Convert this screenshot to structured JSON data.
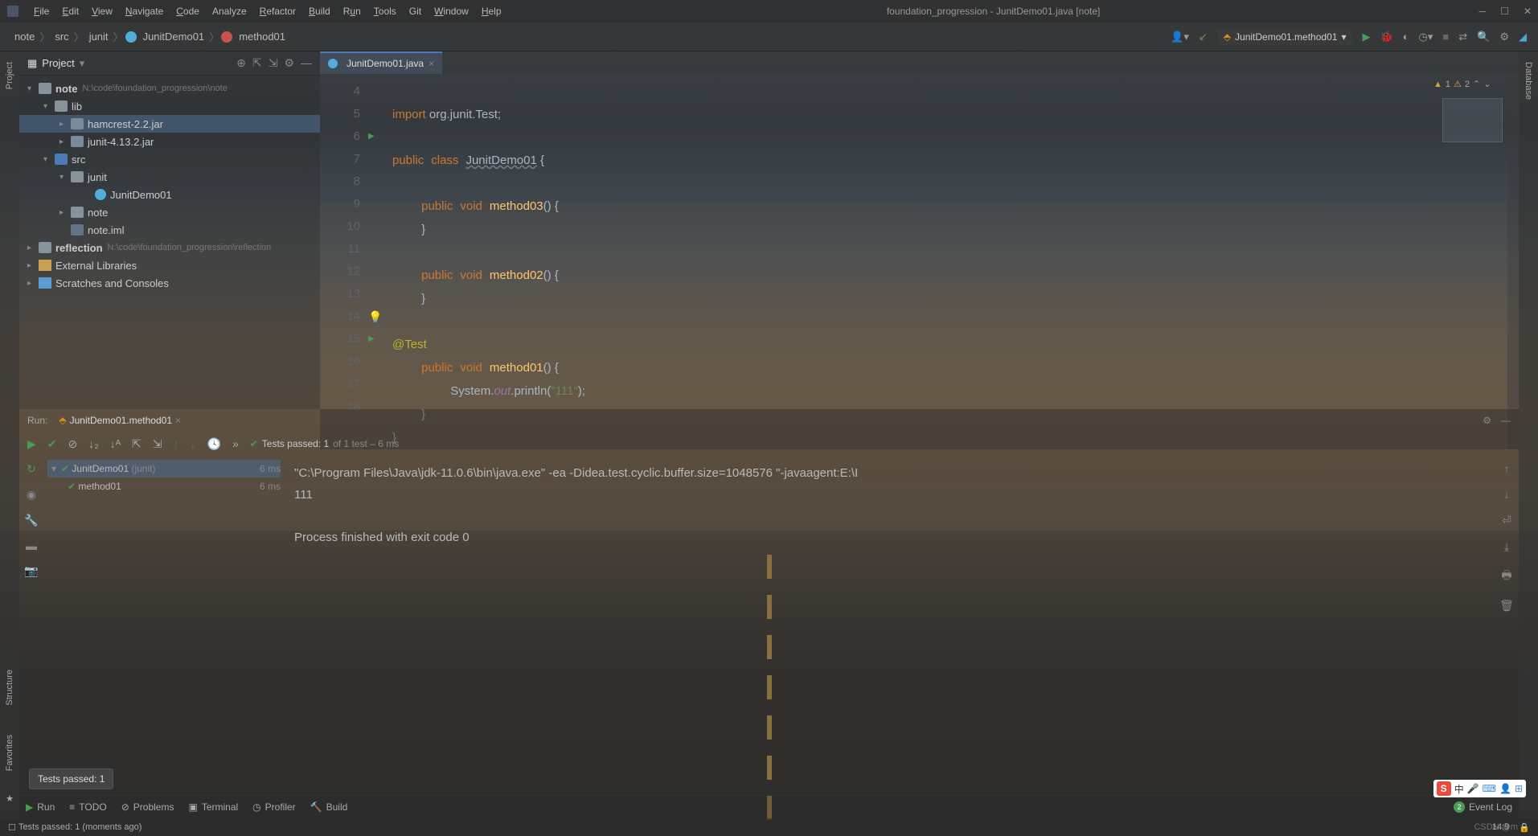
{
  "window": {
    "title": "foundation_progression - JunitDemo01.java [note]"
  },
  "menu": {
    "file": "File",
    "edit": "Edit",
    "view": "View",
    "navigate": "Navigate",
    "code": "Code",
    "analyze": "Analyze",
    "refactor": "Refactor",
    "build": "Build",
    "run": "Run",
    "tools": "Tools",
    "git": "Git",
    "window": "Window",
    "help": "Help"
  },
  "breadcrumbs": {
    "b1": "note",
    "b2": "src",
    "b3": "junit",
    "b4": "JunitDemo01",
    "b5": "method01"
  },
  "runconfig": {
    "label": "JunitDemo01.method01"
  },
  "project": {
    "title": "Project",
    "root": {
      "name": "note",
      "path": "N:\\code\\foundation_progression\\note"
    },
    "lib": "lib",
    "hamcrest": "hamcrest-2.2.jar",
    "junit_jar": "junit-4.13.2.jar",
    "src": "src",
    "pkg_junit": "junit",
    "class1": "JunitDemo01",
    "pkg_note": "note",
    "iml": "note.iml",
    "reflection": {
      "name": "reflection",
      "path": "N:\\code\\foundation_progression\\reflection"
    },
    "extlib": "External Libraries",
    "scratches": "Scratches and Consoles"
  },
  "editor": {
    "tab": "JunitDemo01.java",
    "lines": {
      "l4": "4",
      "l5": "5",
      "l6": "6",
      "l7": "7",
      "l8": "8",
      "l9": "9",
      "l10": "10",
      "l11": "11",
      "l12": "12",
      "l13": "13",
      "l14": "14",
      "l15": "15",
      "l16": "16",
      "l17": "17",
      "l18": "18"
    },
    "code": {
      "import_kw": "import",
      "import_pkg": " org.junit.Test;",
      "public": "public",
      "class_kw": "class",
      "classname": "JunitDemo01",
      "brace_o": " {",
      "brace_c": "}",
      "void": "void",
      "m03": "method03",
      "m02": "method02",
      "m01": "method01",
      "parens": "() {",
      "test_ann": "@Test",
      "sys": "System.",
      "out": "out",
      "println": ".println(",
      "arg": "\"111\"",
      "end": ");"
    },
    "warnings": {
      "w1": "1",
      "w2": "2"
    }
  },
  "run": {
    "label": "Run:",
    "tab": "JunitDemo01.method01",
    "status_prefix": "Tests passed: 1",
    "status_suffix": " of 1 test – 6 ms",
    "tree_root": "JunitDemo01",
    "tree_root_pkg": "(junit)",
    "tree_root_time": "6 ms",
    "tree_m": "method01",
    "tree_m_time": "6 ms",
    "console_l1": "\"C:\\Program Files\\Java\\jdk-11.0.6\\bin\\java.exe\" -ea -Didea.test.cyclic.buffer.size=1048576 \"-javaagent:E:\\I",
    "console_l2": "111",
    "console_l3": "Process finished with exit code 0"
  },
  "bottom": {
    "run": "Run",
    "todo": "TODO",
    "problems": "Problems",
    "terminal": "Terminal",
    "profiler": "Profiler",
    "build": "Build",
    "eventlog": "Event Log"
  },
  "status": {
    "msg": "Tests passed: 1 (moments ago)",
    "pos": "14:9"
  },
  "tooltip": "Tests passed: 1",
  "side": {
    "project": "Project",
    "structure": "Structure",
    "favorites": "Favorites",
    "database": "Database"
  },
  "ime": {
    "cn": "中"
  },
  "watermark": "CSDN @m"
}
